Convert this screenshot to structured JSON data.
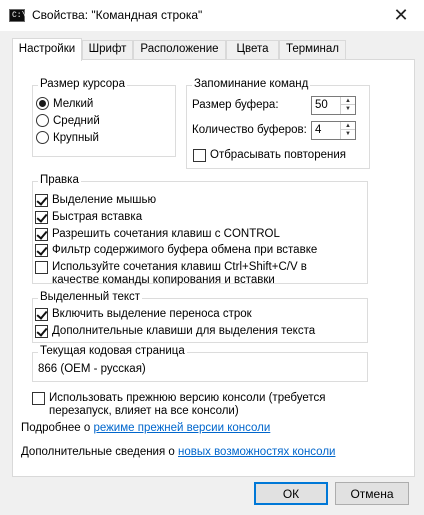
{
  "window": {
    "title": "Свойства: \"Командная строка\"",
    "icon_text": "C:\\",
    "close_glyph": "✕"
  },
  "tabs": [
    {
      "label": "Настройки",
      "active": true
    },
    {
      "label": "Шрифт",
      "active": false
    },
    {
      "label": "Расположение",
      "active": false
    },
    {
      "label": "Цвета",
      "active": false
    },
    {
      "label": "Терминал",
      "active": false
    }
  ],
  "cursor_size": {
    "title": "Размер курсора",
    "options": [
      {
        "label": "Мелкий",
        "selected": true
      },
      {
        "label": "Средний",
        "selected": false
      },
      {
        "label": "Крупный",
        "selected": false
      }
    ]
  },
  "command_history": {
    "title": "Запоминание команд",
    "buffer_size_label": "Размер буфера:",
    "buffer_size_value": "50",
    "buffer_count_label": "Количество буферов:",
    "buffer_count_value": "4",
    "discard_duplicates_label": "Отбрасывать повторения",
    "discard_duplicates_checked": false
  },
  "edit_options": {
    "title": "Правка",
    "items": [
      {
        "label": "Выделение мышью",
        "checked": true
      },
      {
        "label": "Быстрая вставка",
        "checked": true
      },
      {
        "label": "Разрешить сочетания клавиш с CONTROL",
        "checked": true
      },
      {
        "label": "Фильтр содержимого буфера обмена при вставке",
        "checked": true
      },
      {
        "label_line1": "Используйте сочетания клавиш Ctrl+Shift+C/V в",
        "label_line2": "качестве команды копирования и вставки",
        "checked": false
      }
    ]
  },
  "text_selection": {
    "title": "Выделенный текст",
    "items": [
      {
        "label": "Включить выделение переноса строк",
        "checked": true
      },
      {
        "label": "Дополнительные клавиши для выделения текста",
        "checked": true
      }
    ]
  },
  "codepage": {
    "title": "Текущая кодовая страница",
    "value": "866   (OEM - русская)"
  },
  "legacy": {
    "line1": "Использовать прежнюю версию консоли (требуется",
    "line2": "перезапуск, влияет на все консоли)",
    "checked": false,
    "more_prefix": "Подробнее о ",
    "more_link": "режиме прежней версии консоли",
    "new_prefix": "Дополнительные сведения о ",
    "new_link": "новых возможностях консоли"
  },
  "buttons": {
    "ok": "ОК",
    "cancel": "Отмена"
  }
}
